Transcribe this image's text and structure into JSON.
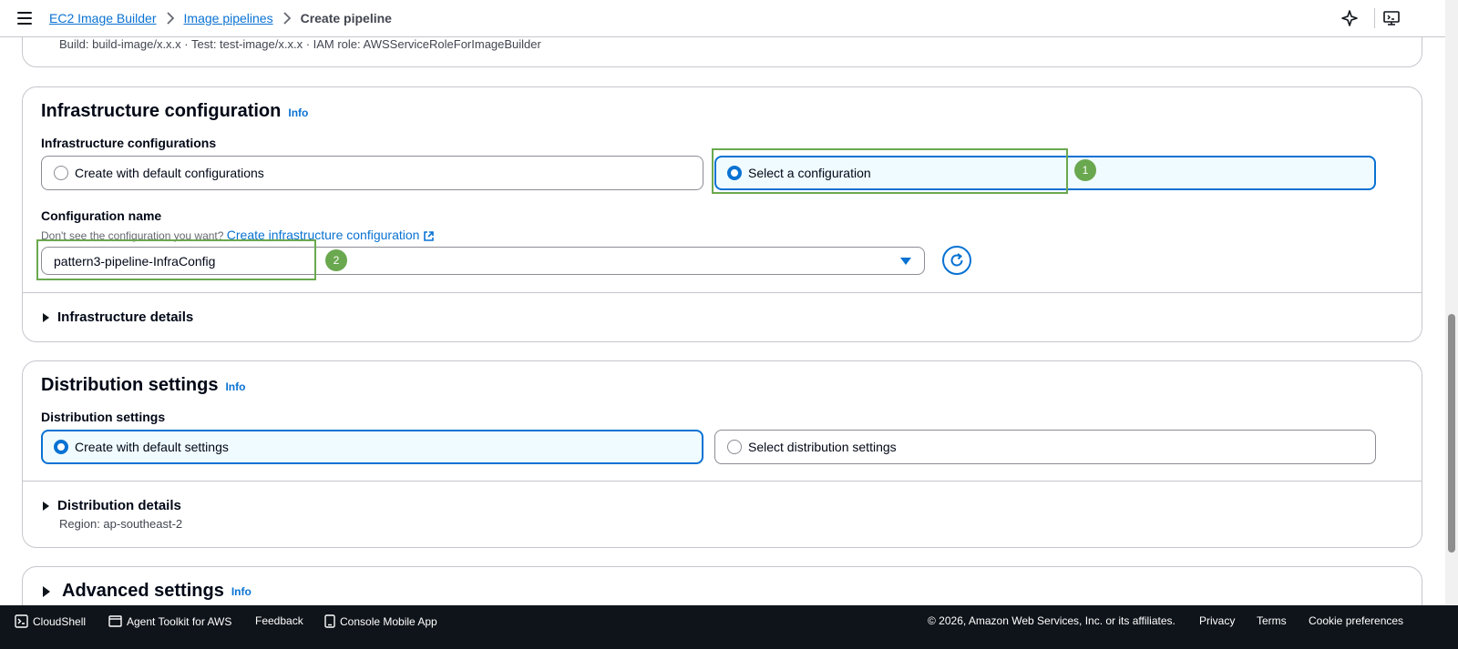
{
  "header": {
    "breadcrumbs": [
      "EC2 Image Builder",
      "Image pipelines"
    ],
    "current": "Create pipeline"
  },
  "recipe_summary": "Build: build-image/x.x.x · Test: test-image/x.x.x · IAM role: AWSServiceRoleForImageBuilder",
  "infrastructure": {
    "title": "Infrastructure configuration",
    "info": "Info",
    "options_label": "Infrastructure configurations",
    "option_default": "Create with default configurations",
    "option_select": "Select a configuration",
    "config_name_label": "Configuration name",
    "hint": "Don't see the configuration you want?",
    "create_link": "Create infrastructure configuration",
    "selected_value": "pattern3-pipeline-InfraConfig",
    "details": "Infrastructure details"
  },
  "distribution": {
    "title": "Distribution settings",
    "info": "Info",
    "options_label": "Distribution settings",
    "option_default": "Create with default settings",
    "option_select": "Select distribution settings",
    "details": "Distribution details",
    "region": "Region: ap-southeast-2"
  },
  "advanced": {
    "title": "Advanced settings",
    "info": "Info"
  },
  "annotations": [
    "1",
    "2"
  ],
  "footer": {
    "cloudshell": "CloudShell",
    "agent_toolkit": "Agent Toolkit for AWS",
    "feedback": "Feedback",
    "mobile_app": "Console Mobile App",
    "copyright": "© 2026, Amazon Web Services, Inc. or its affiliates.",
    "privacy": "Privacy",
    "terms": "Terms",
    "cookies": "Cookie preferences"
  },
  "colors": {
    "accent": "#0972d3",
    "annotation": "#6aa84f",
    "footer_bg": "#0f141a"
  }
}
